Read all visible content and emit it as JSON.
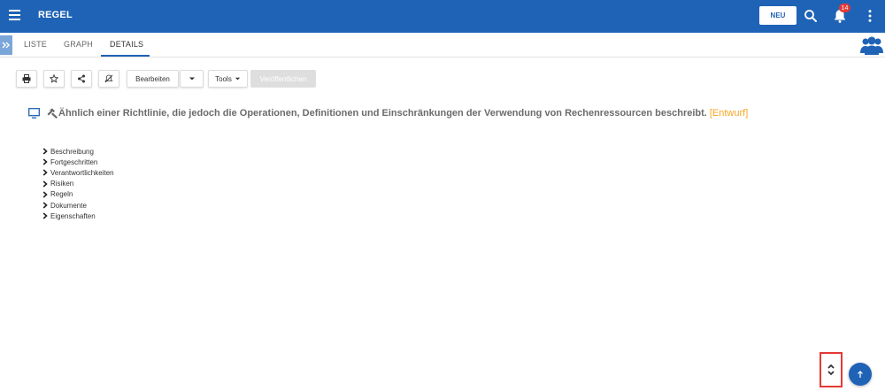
{
  "header": {
    "app_title": "REGEL",
    "new_label": "NEU",
    "notification_count": "14"
  },
  "tabs": [
    {
      "label": "LISTE",
      "active": false
    },
    {
      "label": "GRAPH",
      "active": false
    },
    {
      "label": "DETAILS",
      "active": true
    }
  ],
  "toolbar": {
    "edit_label": "Bearbeiten",
    "tools_label": "Tools",
    "publish_label": "Veröffentlichen"
  },
  "record": {
    "title": "Ähnlich einer Richtlinie, die jedoch die Operationen, Definitionen und Einschränkungen der Verwendung von Rechenressourcen beschreibt.",
    "status": "[Entwurf]"
  },
  "sections": [
    "Beschreibung",
    "Fortgeschritten",
    "Verantwortlichkeiten",
    "Risiken",
    "Regeln",
    "Dokumente",
    "Eigenschaften"
  ],
  "colors": {
    "brand": "#1f63b6",
    "status": "#f5a623",
    "badge": "#e53935"
  },
  "icons": [
    "menu-icon",
    "search-icon",
    "bell-icon",
    "more-vertical-icon",
    "users-icon",
    "print-icon",
    "star-icon",
    "share-icon",
    "bell-off-icon",
    "monitor-icon",
    "hammer-icon",
    "chevron-right-icon",
    "arrow-up-icon"
  ]
}
